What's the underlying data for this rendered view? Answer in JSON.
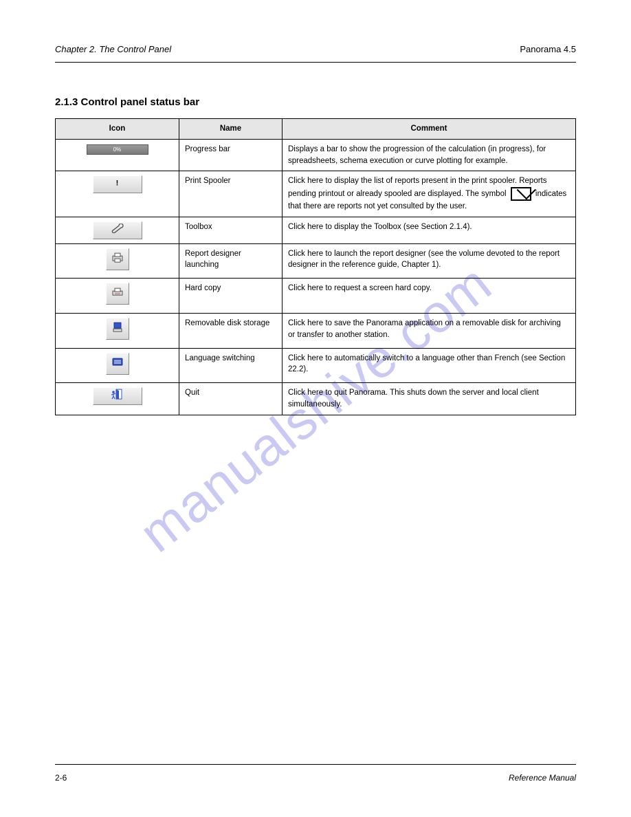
{
  "header": {
    "left": "Chapter 2. The Control Panel",
    "right": "Panorama 4.5"
  },
  "section_title": "2.1.3 Control panel status bar",
  "table": {
    "headers": [
      "Icon",
      "Name",
      "Comment"
    ],
    "rows": [
      {
        "name": "Progress bar",
        "comment": "Displays a bar to show the progression of the calculation (in progress), for spreadsheets, schema execution or curve plotting for example."
      },
      {
        "name": "Print Spooler",
        "comment_before": "Click here to display the list of reports present in the print spooler. Reports pending printout or already spooled are displayed. The symbol ",
        "comment_after": " indicates that there are reports not yet consulted by the user."
      },
      {
        "name": "Toolbox",
        "comment": "Click here to display the Toolbox (see Section 2.1.4)."
      },
      {
        "name": "Report designer launching",
        "comment": "Click here to launch the report designer (see the volume devoted to the report designer in the reference guide, Chapter 1)."
      },
      {
        "name": "Hard copy",
        "comment": "Click here to request a screen hard copy."
      },
      {
        "name": "Removable disk storage",
        "comment": "Click here to save the Panorama application on a removable disk for archiving or transfer to another station."
      },
      {
        "name": "Language switching",
        "comment": "Click here to automatically switch to a language other than French (see Section 22.2)."
      },
      {
        "name": "Quit",
        "comment": "Click here to quit Panorama. This shuts down the server and local client simultaneously."
      }
    ]
  },
  "footer": {
    "left": "2-6",
    "right": "Reference Manual"
  },
  "watermark": "manualshive.com"
}
